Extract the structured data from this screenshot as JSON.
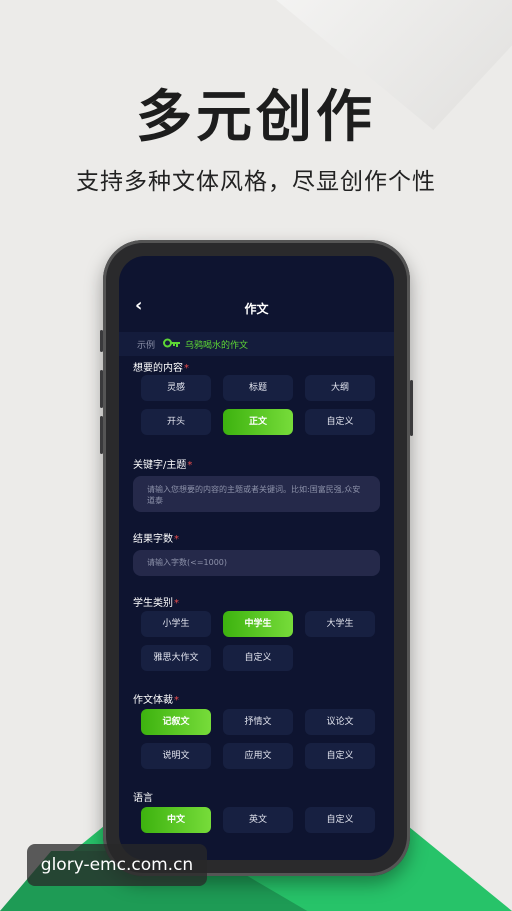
{
  "promo": {
    "headline": "多元创作",
    "subline": "支持多种文体风格，尽显创作个性"
  },
  "app": {
    "nav_title": "作文",
    "back_icon": "‹",
    "example": {
      "label": "示例",
      "link": "乌鸦喝水的作文"
    },
    "sections": {
      "content": {
        "label": "想要的内容",
        "options": [
          "灵感",
          "标题",
          "大纲",
          "开头",
          "正文",
          "自定义"
        ],
        "selected": "正文"
      },
      "keywords": {
        "label": "关键字/主题",
        "placeholder": "请输入您想要的内容的主题或者关键词。比如:国富民强,众安道泰"
      },
      "word_count": {
        "label": "结果字数",
        "placeholder": "请输入字数(<=1000)"
      },
      "student": {
        "label": "学生类别",
        "options": [
          "小学生",
          "中学生",
          "大学生",
          "雅思大作文",
          "自定义"
        ],
        "selected": "中学生"
      },
      "genre": {
        "label": "作文体裁",
        "options": [
          "记叙文",
          "抒情文",
          "议论文",
          "说明文",
          "应用文",
          "自定义"
        ],
        "selected": "记叙文"
      },
      "language": {
        "label": "语言",
        "options": [
          "中文",
          "英文",
          "自定义"
        ],
        "selected": "中文"
      }
    }
  },
  "colors": {
    "accent_green": "#5dd635",
    "screen_bg": "#0e1430",
    "chip_bg": "#172041",
    "required_star": "#e74c4c"
  },
  "watermark": "glory-emc.com.cn"
}
